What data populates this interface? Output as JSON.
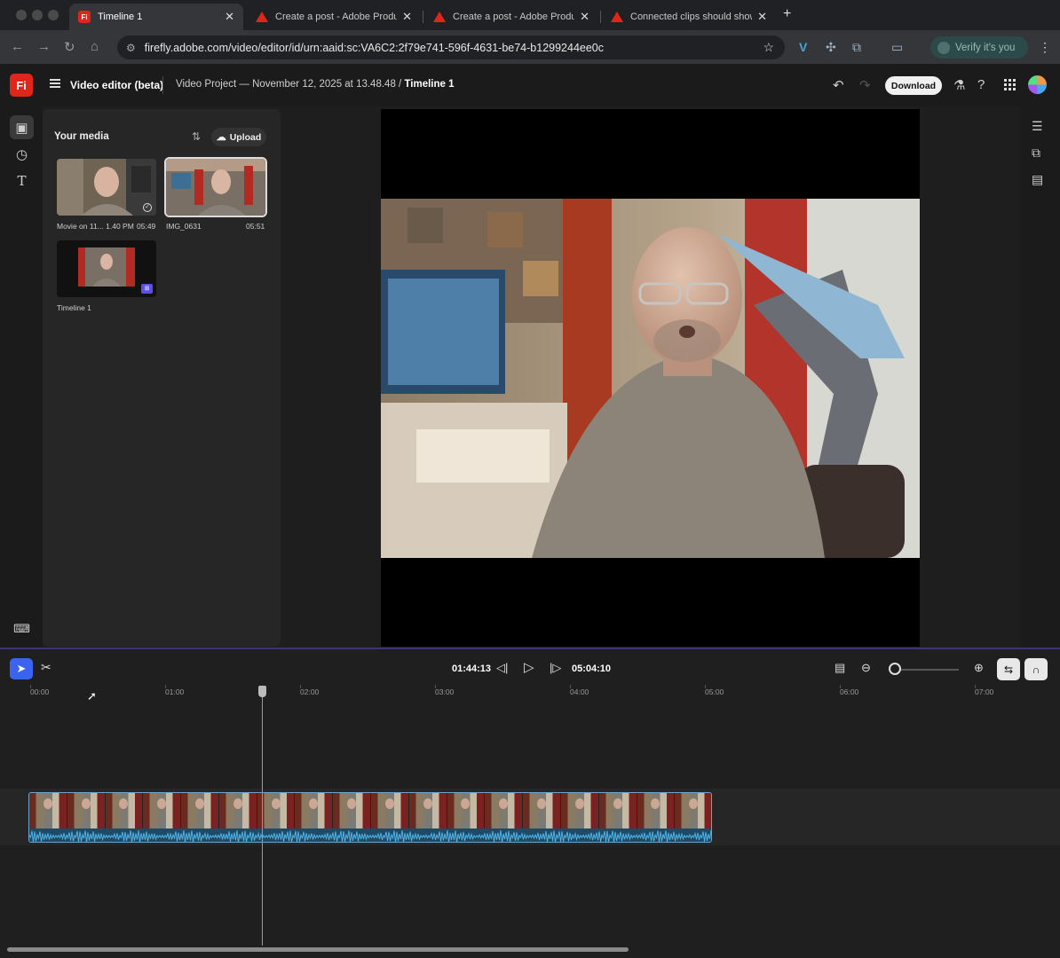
{
  "browser": {
    "tabs": [
      {
        "title": "Timeline 1",
        "active": true,
        "favicon": "firefly-icon"
      },
      {
        "title": "Create a post - Adobe Produ",
        "active": false,
        "favicon": "adobe-icon"
      },
      {
        "title": "Create a post - Adobe Produ",
        "active": false,
        "favicon": "adobe-icon"
      },
      {
        "title": "Connected clips should show",
        "active": false,
        "favicon": "adobe-icon"
      }
    ],
    "url": "firefly.adobe.com/video/editor/id/urn:aaid:sc:VA6C2:2f79e741-596f-4631-be74-b1299244ee0c",
    "verify_label": "Verify it's you"
  },
  "app": {
    "logo": "Fi",
    "title": "Video editor (beta)",
    "breadcrumb_project": "Video Project — November 12, 2025 at 13.48.48",
    "breadcrumb_sep": "/",
    "breadcrumb_current": "Timeline 1",
    "download_label": "Download"
  },
  "media": {
    "title": "Your media",
    "upload_label": "Upload",
    "items": [
      {
        "name": "Movie on 11... 1.40 PM",
        "duration": "05:49"
      },
      {
        "name": "IMG_0631",
        "duration": "05:51"
      },
      {
        "name": "Timeline 1",
        "duration": ""
      }
    ]
  },
  "timeline": {
    "current_time": "01:44:13",
    "total_time": "05:04:10",
    "ruler": [
      "00:00",
      "01:00",
      "02:00",
      "03:00",
      "04:00",
      "05:00",
      "06:00",
      "07:00"
    ]
  },
  "colors": {
    "accent": "#3b63f0",
    "brand": "#e0251b",
    "clip_border": "#6aa4cc"
  }
}
